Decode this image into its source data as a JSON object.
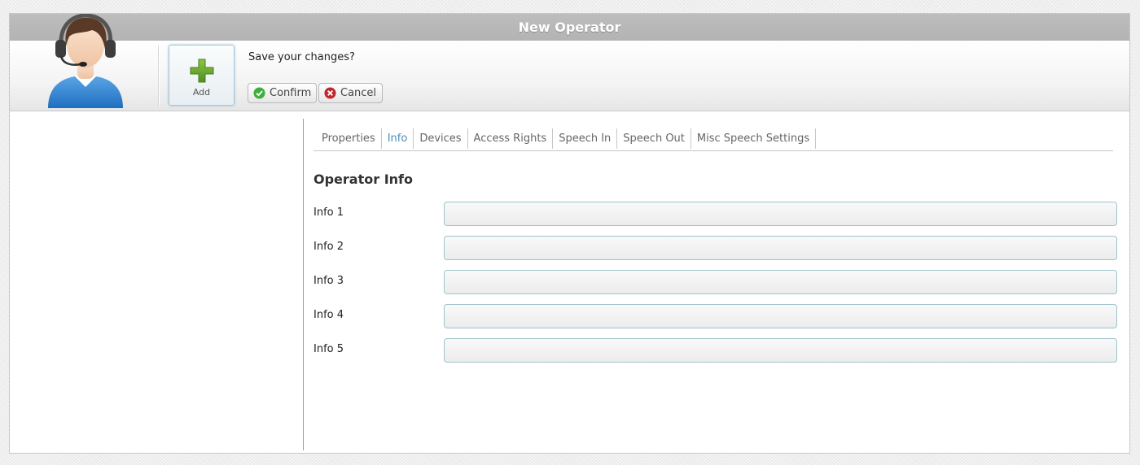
{
  "window": {
    "title": "New Operator"
  },
  "toolbar": {
    "add_label": "Add",
    "prompt": "Save your changes?",
    "confirm_label": "Confirm",
    "cancel_label": "Cancel"
  },
  "tabs": [
    {
      "label": "Properties",
      "active": false
    },
    {
      "label": "Info",
      "active": true
    },
    {
      "label": "Devices",
      "active": false
    },
    {
      "label": "Access Rights",
      "active": false
    },
    {
      "label": "Speech In",
      "active": false
    },
    {
      "label": "Speech Out",
      "active": false
    },
    {
      "label": "Misc Speech Settings",
      "active": false
    }
  ],
  "form": {
    "title": "Operator Info",
    "fields": [
      {
        "label": "Info 1",
        "value": ""
      },
      {
        "label": "Info 2",
        "value": ""
      },
      {
        "label": "Info 3",
        "value": ""
      },
      {
        "label": "Info 4",
        "value": ""
      },
      {
        "label": "Info 5",
        "value": ""
      }
    ]
  },
  "colors": {
    "titlebar": "#b8b8b8",
    "active_tab": "#4a8fb8",
    "input_border": "#9ec3cc",
    "confirm_green": "#3fae3c",
    "cancel_red": "#c0282d",
    "add_plus_green": "#5ea12b"
  },
  "icons": {
    "avatar": "operator-headset-avatar",
    "add": "plus-icon",
    "confirm": "check-circle-icon",
    "cancel": "x-circle-icon"
  }
}
